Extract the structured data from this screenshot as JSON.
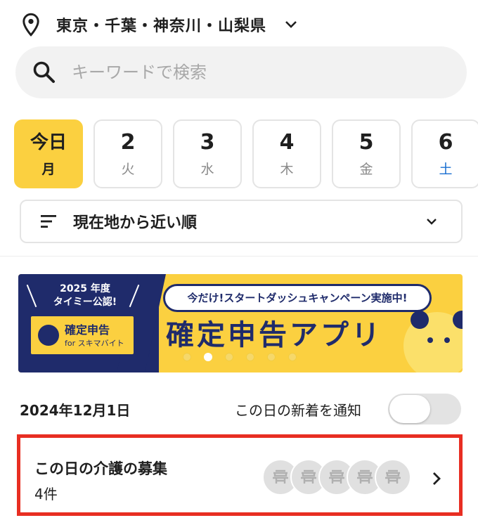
{
  "location": {
    "label": "東京・千葉・神奈川・山梨県",
    "icon": "location-pin-icon"
  },
  "search": {
    "placeholder": "キーワードで検索",
    "value": ""
  },
  "dates": [
    {
      "day": "今日",
      "weekday": "月",
      "active": true
    },
    {
      "day": "2",
      "weekday": "火",
      "active": false
    },
    {
      "day": "3",
      "weekday": "水",
      "active": false
    },
    {
      "day": "4",
      "weekday": "木",
      "active": false
    },
    {
      "day": "5",
      "weekday": "金",
      "active": false
    },
    {
      "day": "6",
      "weekday": "土",
      "active": false
    }
  ],
  "sort": {
    "label": "現在地から近い順"
  },
  "banner": {
    "year_line1": "2025 年度",
    "year_line2": "タイミー公認!",
    "logo_title": "確定申告",
    "logo_sub": "for スキマバイト",
    "campaign": "今だけ!スタートダッシュキャンペーン実施中!",
    "headline": "確定申告アプリ",
    "slides": 6,
    "current_slide": 2
  },
  "day_section": {
    "date": "2024年12月1日",
    "notify_label": "この日の新着を通知",
    "notify_on": false
  },
  "job_card": {
    "title": "この日の介護の募集",
    "count": "4件",
    "avatar_count": 5
  },
  "colors": {
    "accent": "#fbd040",
    "navy": "#1f2b6b",
    "highlight": "#e82e22",
    "saturday": "#1a6fd1"
  }
}
